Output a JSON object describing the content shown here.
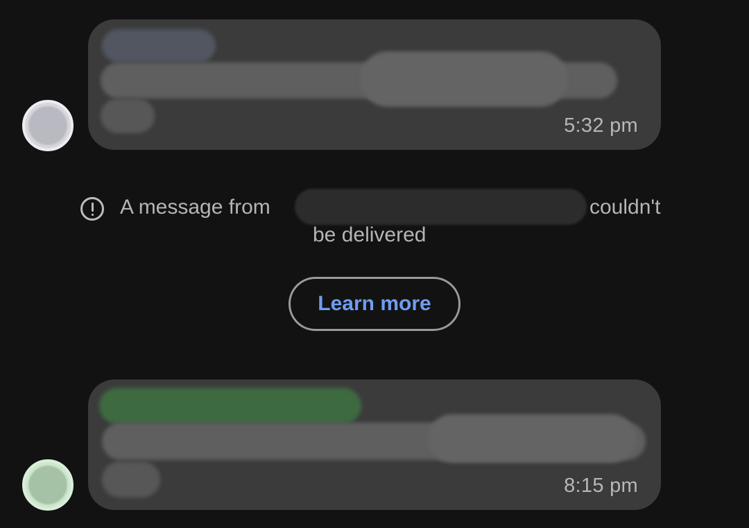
{
  "conversation": {
    "messages": [
      {
        "timestamp": "5:32 pm",
        "sender_redacted": true,
        "body_redacted": true
      },
      {
        "timestamp": "8:15 pm",
        "sender_redacted": true,
        "body_redacted": true
      }
    ],
    "delivery_notice": {
      "icon": "alert-circle-icon",
      "text_before": "A message from",
      "text_after": "couldn't",
      "text_line2": "be delivered"
    },
    "learn_more_label": "Learn more"
  },
  "colors": {
    "background": "#121212",
    "bubble": "#3b3b3b",
    "accent_link": "#6f9df1",
    "sender_1_name": "#515660",
    "sender_2_name": "#3e6a40"
  }
}
